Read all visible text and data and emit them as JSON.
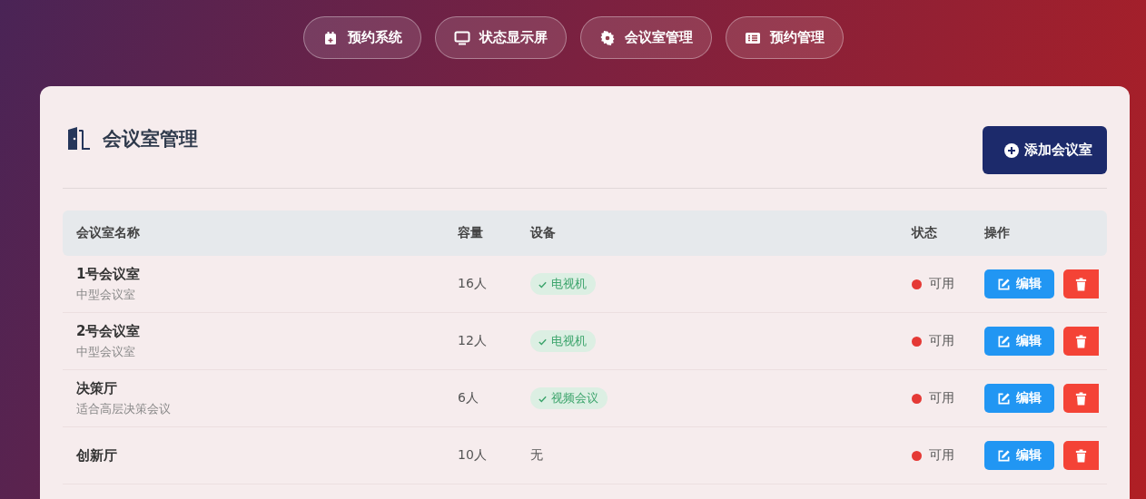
{
  "nav": [
    {
      "kind": "calendar",
      "label": "预约系统"
    },
    {
      "kind": "monitor",
      "label": "状态显示屏"
    },
    {
      "kind": "gear",
      "label": "会议室管理"
    },
    {
      "kind": "list",
      "label": "预约管理"
    }
  ],
  "panel": {
    "title": "会议室管理",
    "add_button": "添加会议室"
  },
  "table": {
    "columns": [
      "会议室名称",
      "容量",
      "设备",
      "状态",
      "操作"
    ],
    "rows": [
      {
        "name": "1号会议室",
        "description": "中型会议室",
        "capacity": "16人",
        "equipment": [
          "电视机"
        ],
        "status": "可用",
        "color": "#e53935",
        "edit": "编辑"
      },
      {
        "name": "2号会议室",
        "description": "中型会议室",
        "capacity": "12人",
        "equipment": [
          "电视机"
        ],
        "status": "可用",
        "color": "#e53935",
        "edit": "编辑"
      },
      {
        "name": "决策厅",
        "description": "适合高层决策会议",
        "capacity": "6人",
        "equipment": [
          "视频会议"
        ],
        "status": "可用",
        "color": "#e53935",
        "edit": "编辑"
      },
      {
        "name": "创新厅",
        "capacity": "10人",
        "equipment_text": "无",
        "status": "可用",
        "color": "#e53935",
        "edit": "编辑"
      }
    ]
  }
}
